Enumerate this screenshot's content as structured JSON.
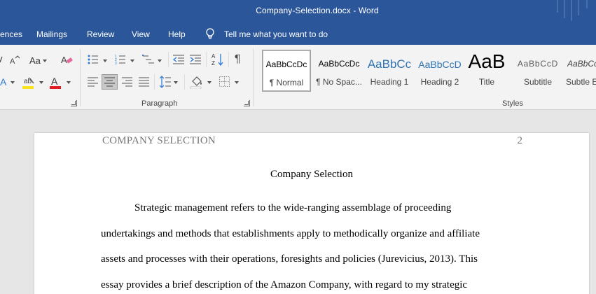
{
  "titlebar": {
    "title": "Company-Selection.docx  -  Word"
  },
  "tabs": {
    "items": [
      "ences",
      "Mailings",
      "Review",
      "View",
      "Help"
    ],
    "tell_me": "Tell me what you want to do"
  },
  "ribbon": {
    "font_size_label": "Aa",
    "sort_label": "A Z",
    "paragraph_label": "Paragraph",
    "styles_label": "Styles",
    "styles": [
      {
        "preview": "AaBbCcDc",
        "name": "¶ Normal"
      },
      {
        "preview": "AaBbCcDc",
        "name": "¶ No Spac..."
      },
      {
        "preview": "AaBbCc",
        "name": "Heading 1"
      },
      {
        "preview": "AaBbCcD",
        "name": "Heading 2"
      },
      {
        "preview": "AaB",
        "name": "Title"
      },
      {
        "preview": "AaBbCcD",
        "name": "Subtitle"
      },
      {
        "preview": "AaBbCc",
        "name": "Subtle E"
      }
    ],
    "colors": {
      "highlight": "#f5e31c",
      "font_color": "#e02020",
      "accent": "#2b579a"
    }
  },
  "document": {
    "header_title": "COMPANY SELECTION",
    "page_number": "2",
    "title": "Company Selection",
    "lines": [
      "Strategic management refers to the wide-ranging assemblage of proceeding",
      "undertakings and methods that establishments apply to methodically organize and affiliate",
      "assets and processes with their operations, foresights and policies (Jurevicius, 2013). This",
      "essay provides a brief description of the Amazon Company, with regard to my strategic"
    ]
  }
}
